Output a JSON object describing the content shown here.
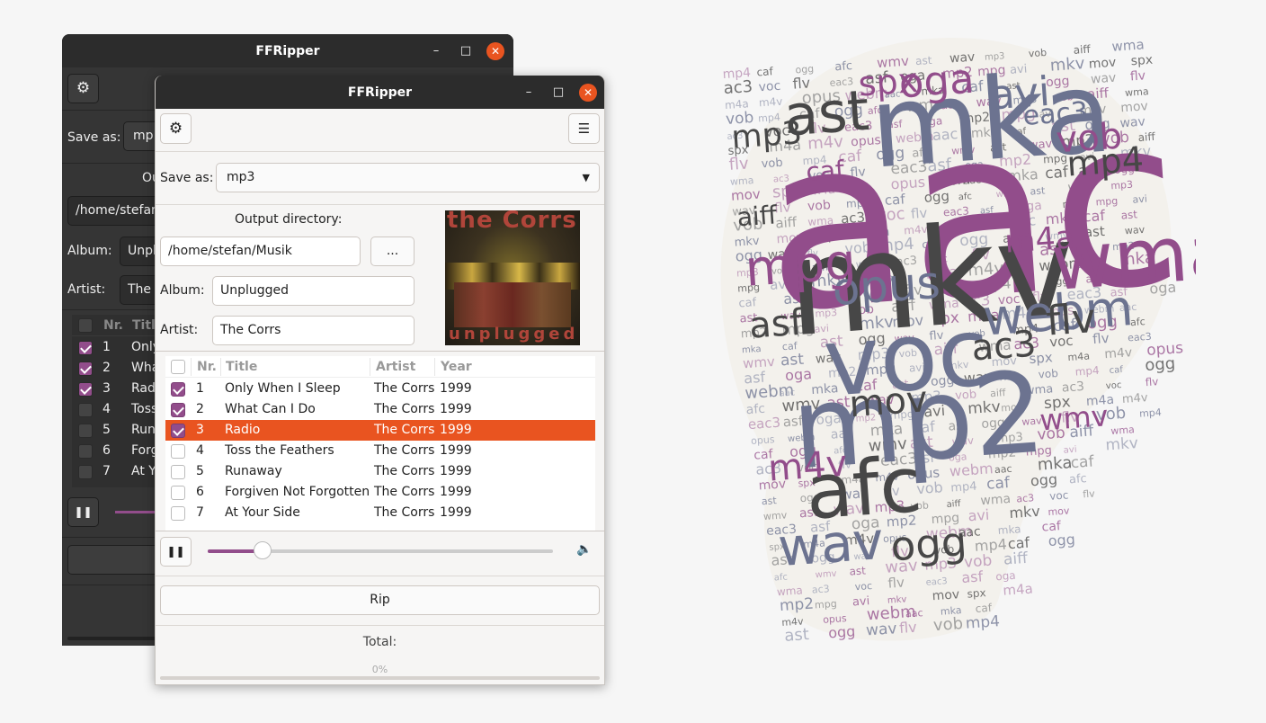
{
  "app_title": "FFRipper",
  "window_controls": {
    "minimize": "–",
    "maximize": "□",
    "close": "✕"
  },
  "save_as": {
    "label": "Save as:",
    "value": "mp3",
    "back_value_visible": "mp"
  },
  "output": {
    "label": "Output directory:",
    "back_label_visible": "Ou",
    "path": "/home/stefan/Musik",
    "back_path_visible": "/home/stefan",
    "browse_label": "..."
  },
  "album": {
    "label": "Album:",
    "value": "Unplugged"
  },
  "artist": {
    "label": "Artist:",
    "value": "The Corrs"
  },
  "album_art": {
    "top_text": "the Corrs",
    "bottom_text": "unplugged"
  },
  "table": {
    "headers": {
      "nr": "Nr.",
      "title": "Title",
      "artist": "Artist",
      "year": "Year"
    },
    "selected_index": 2,
    "tracks": [
      {
        "checked": true,
        "nr": "1",
        "title": "Only When I Sleep",
        "artist": "The Corrs",
        "year": "1999"
      },
      {
        "checked": true,
        "nr": "2",
        "title": "What Can I Do",
        "artist": "The Corrs",
        "year": "1999"
      },
      {
        "checked": true,
        "nr": "3",
        "title": "Radio",
        "artist": "The Corrs",
        "year": "1999"
      },
      {
        "checked": false,
        "nr": "4",
        "title": "Toss the Feathers",
        "artist": "The Corrs",
        "year": "1999"
      },
      {
        "checked": false,
        "nr": "5",
        "title": "Runaway",
        "artist": "The Corrs",
        "year": "1999"
      },
      {
        "checked": false,
        "nr": "6",
        "title": "Forgiven Not Forgotten",
        "artist": "The Corrs",
        "year": "1999"
      },
      {
        "checked": false,
        "nr": "7",
        "title": "At Your Side",
        "artist": "The Corrs",
        "year": "1999"
      }
    ]
  },
  "player": {
    "playing": true,
    "position_fraction": 0.16,
    "volume_icon": "speaker-icon"
  },
  "rip": {
    "label": "Rip"
  },
  "total": {
    "label": "Total:",
    "progress_text": "0%",
    "progress": 0
  },
  "colors": {
    "accent": "#924d8b",
    "selection": "#e95420",
    "close": "#e95420"
  },
  "logo_words": {
    "big": [
      "aac",
      "mka",
      "mkv",
      "voc",
      "mp2",
      "afc",
      "wma",
      "webm",
      "opus",
      "mpg",
      "ast",
      "oga",
      "avi",
      "ogg",
      "wav",
      "flv",
      "ac3",
      "mov",
      "vob",
      "mp4",
      "spx",
      "caf",
      "asf",
      "aiff",
      "m4v",
      "eac3",
      "m4a",
      "wmv",
      "mp3"
    ],
    "small": [
      "mp4",
      "caf",
      "ogg",
      "afc",
      "wmv",
      "ast",
      "wav",
      "mp3",
      "vob",
      "aiff",
      "wma",
      "ac3",
      "voc",
      "flv",
      "eac3",
      "asf",
      "oga",
      "mp2",
      "mpg",
      "avi",
      "mkv",
      "mov",
      "spx",
      "m4a",
      "m4v",
      "opus",
      "webm",
      "aac",
      "mka",
      "caf",
      "ast",
      "ogg",
      "wav",
      "flv",
      "vob"
    ]
  }
}
